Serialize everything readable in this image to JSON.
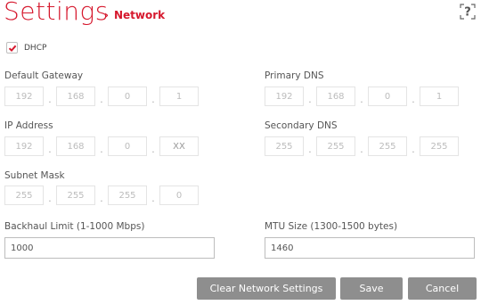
{
  "header": {
    "title": "Settings",
    "breadcrumb": "Network",
    "chevron_icon": "chevron-right-icon",
    "help_icon": "help-icon"
  },
  "dhcp": {
    "label": "DHCP",
    "checked": true
  },
  "default_gateway": {
    "label": "Default Gateway",
    "octets": [
      "192",
      "168",
      "0",
      "1"
    ]
  },
  "primary_dns": {
    "label": "Primary DNS",
    "octets": [
      "192",
      "168",
      "0",
      "1"
    ]
  },
  "ip_address": {
    "label": "IP Address",
    "octets": [
      "192",
      "168",
      "0",
      "XX"
    ]
  },
  "secondary_dns": {
    "label": "Secondary DNS",
    "octets": [
      "255",
      "255",
      "255",
      "255"
    ]
  },
  "subnet_mask": {
    "label": "Subnet Mask",
    "octets": [
      "255",
      "255",
      "255",
      "0"
    ]
  },
  "backhaul": {
    "label": "Backhaul Limit (1-1000 Mbps)",
    "value": "1000"
  },
  "mtu": {
    "label": "MTU Size (1300-1500 bytes)",
    "value": "1460"
  },
  "buttons": {
    "clear": "Clear Network Settings",
    "save": "Save",
    "cancel": "Cancel"
  },
  "colors": {
    "accent": "#d6182d",
    "button": "#8e8e8e"
  }
}
